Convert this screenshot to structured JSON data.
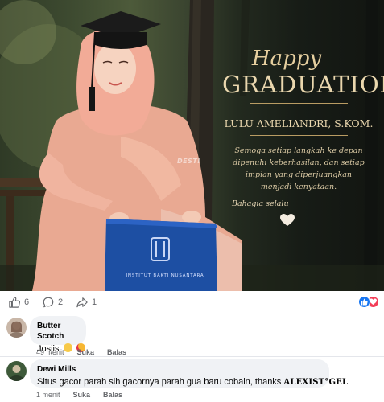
{
  "post": {
    "happy": "Happy",
    "graduation": "GRADUATION",
    "graduate_name": "LULU AMELIANDRI, S.KOM.",
    "quote_lines": [
      "Semoga setiap langkah ke depan",
      "dipenuhi keberhasilan, dan setiap",
      "impian yang diperjuangkan",
      "menjadi kenyataan."
    ],
    "signature": "Bahagia selalu",
    "watermark": "DESTI",
    "cover_text": "INSTITUT BAKTI NUSANTARA"
  },
  "reactions": {
    "like_count": "6",
    "comment_count": "2",
    "share_count": "1",
    "summary_icons": [
      "like-icon",
      "love-icon"
    ],
    "colors": {
      "like": "#1877f2",
      "love": "#f33e58",
      "muted": "#65676b"
    }
  },
  "comments": [
    {
      "author": "Butter Scotch",
      "text": "Josjis",
      "emoji": [
        "grinning-sweat-emoji",
        "heart-eyes-emoji"
      ],
      "time": "49 menit",
      "like_label": "Suka",
      "reply_label": "Balas"
    },
    {
      "author": "Dewi Mills",
      "text": "Situs gacor parah sih gacornya parah gua baru cobain, thanks",
      "highlight": "ALEXIST°GEL",
      "time": "1 menit",
      "like_label": "Suka",
      "reply_label": "Balas"
    }
  ]
}
